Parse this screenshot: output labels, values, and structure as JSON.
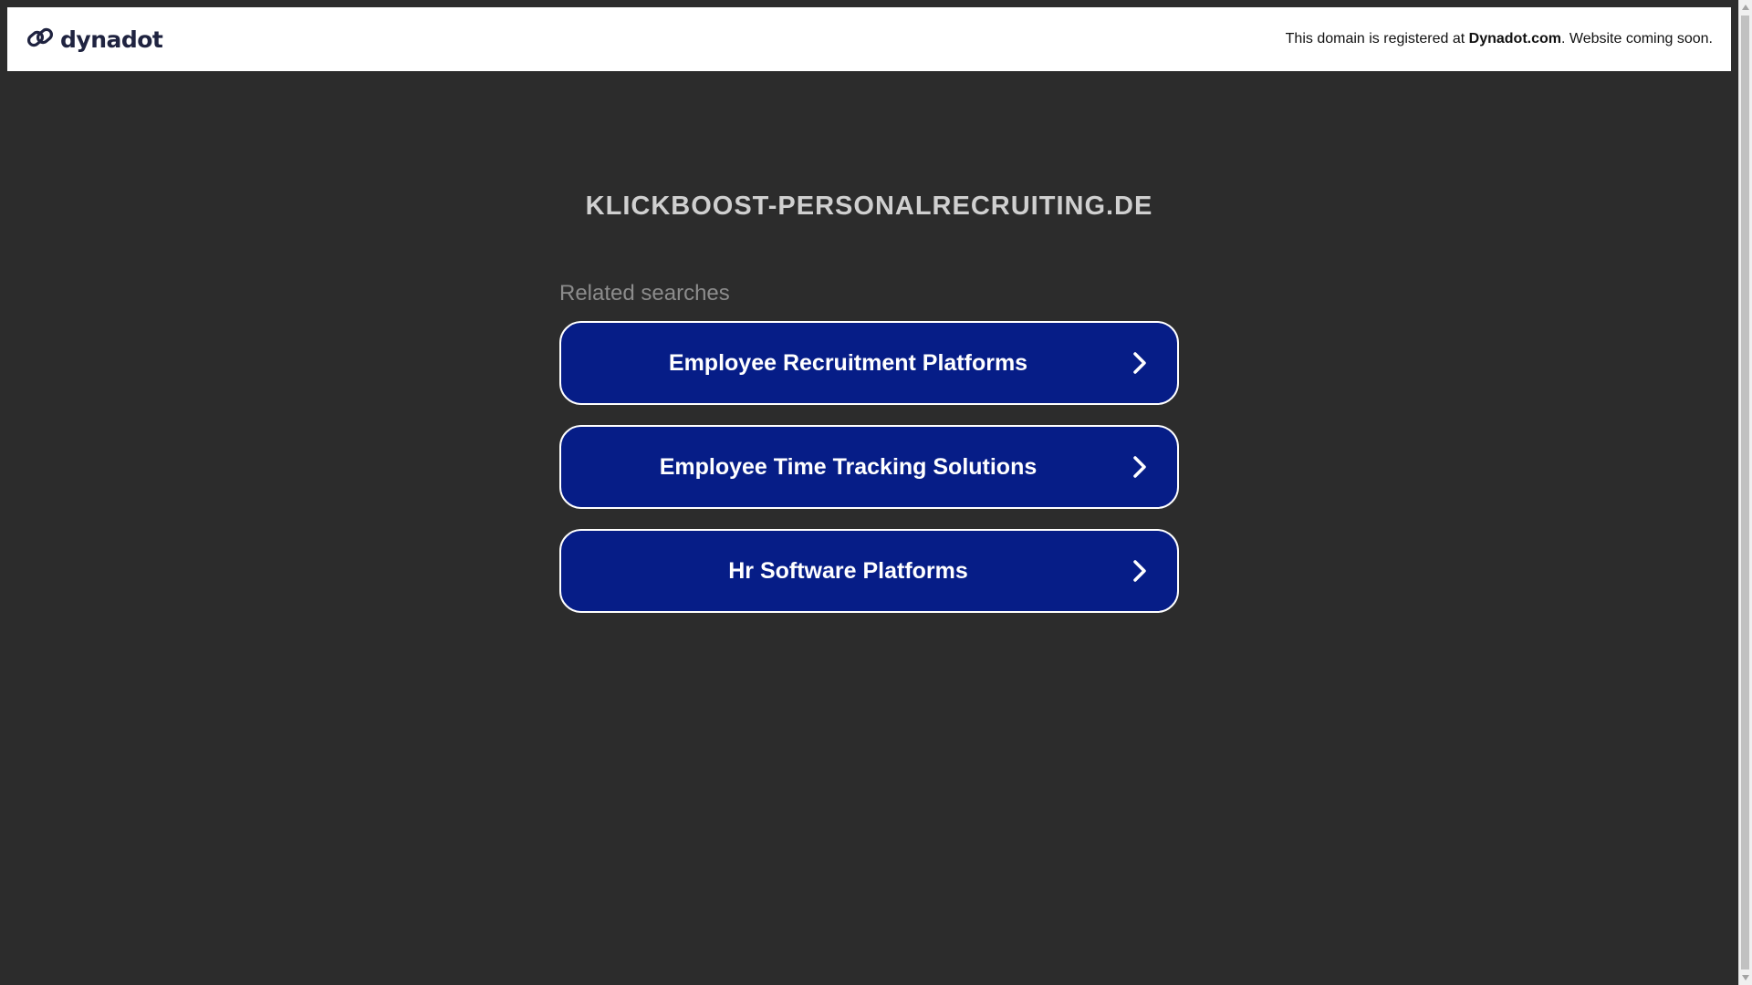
{
  "header": {
    "logo_text": "dynadot",
    "notice_prefix": "This domain is registered at ",
    "notice_brand": "Dynadot.com",
    "notice_suffix": ". Website coming soon."
  },
  "main": {
    "domain_title": "KLICKBOOST-PERSONALRECRUITING.DE",
    "related_label": "Related searches",
    "searches": [
      {
        "label": "Employee Recruitment Platforms"
      },
      {
        "label": "Employee Time Tracking Solutions"
      },
      {
        "label": "Hr Software Platforms"
      }
    ]
  },
  "colors": {
    "background": "#2c2c2c",
    "button_fill": "#061d87",
    "button_border": "#ffffff",
    "logo_color": "#1f2340"
  },
  "icons": {
    "logo": "dynadot-link-icon",
    "button_chevron": "chevron-right-icon"
  }
}
